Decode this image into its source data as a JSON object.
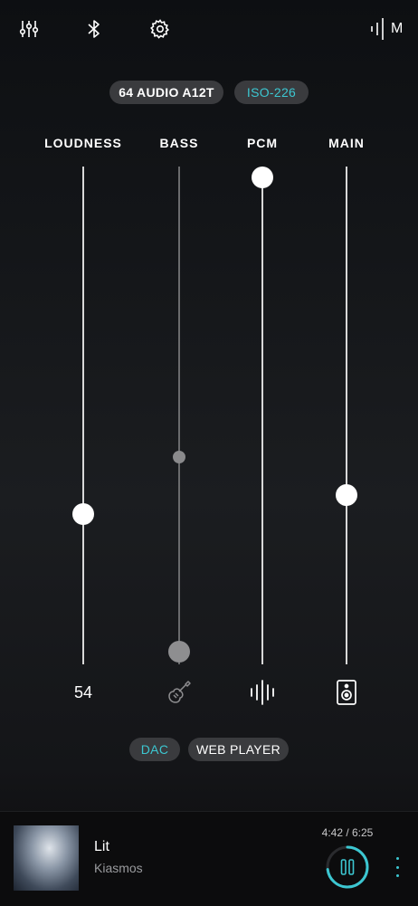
{
  "toolbar": {
    "icons": [
      "equalizer-icon",
      "bluetooth-icon",
      "gear-icon"
    ],
    "mode_label": "M"
  },
  "device_chip": {
    "label": "64 AUDIO A12T",
    "color": "#ffffff"
  },
  "curve_chip": {
    "label": "ISO-226",
    "color": "#3cc7d1"
  },
  "columns": [
    {
      "label": "LOUDNESS",
      "level": 0.29,
      "value_text": "54"
    },
    {
      "label": "BASS",
      "level": 0.0,
      "target_level": 0.41,
      "icon": "guitar-icon"
    },
    {
      "label": "PCM",
      "level": 1.0,
      "icon": "waveform-icon"
    },
    {
      "label": "MAIN",
      "level": 0.33,
      "icon": "speaker-icon"
    }
  ],
  "output_chips": [
    {
      "label": "DAC",
      "active": true
    },
    {
      "label": "WEB PLAYER",
      "active": false
    }
  ],
  "accent_color": "#3cc7d1",
  "now_playing": {
    "title": "Lit",
    "artist": "Kiasmos",
    "time": "4:42 / 6:25",
    "progress": 0.73
  }
}
